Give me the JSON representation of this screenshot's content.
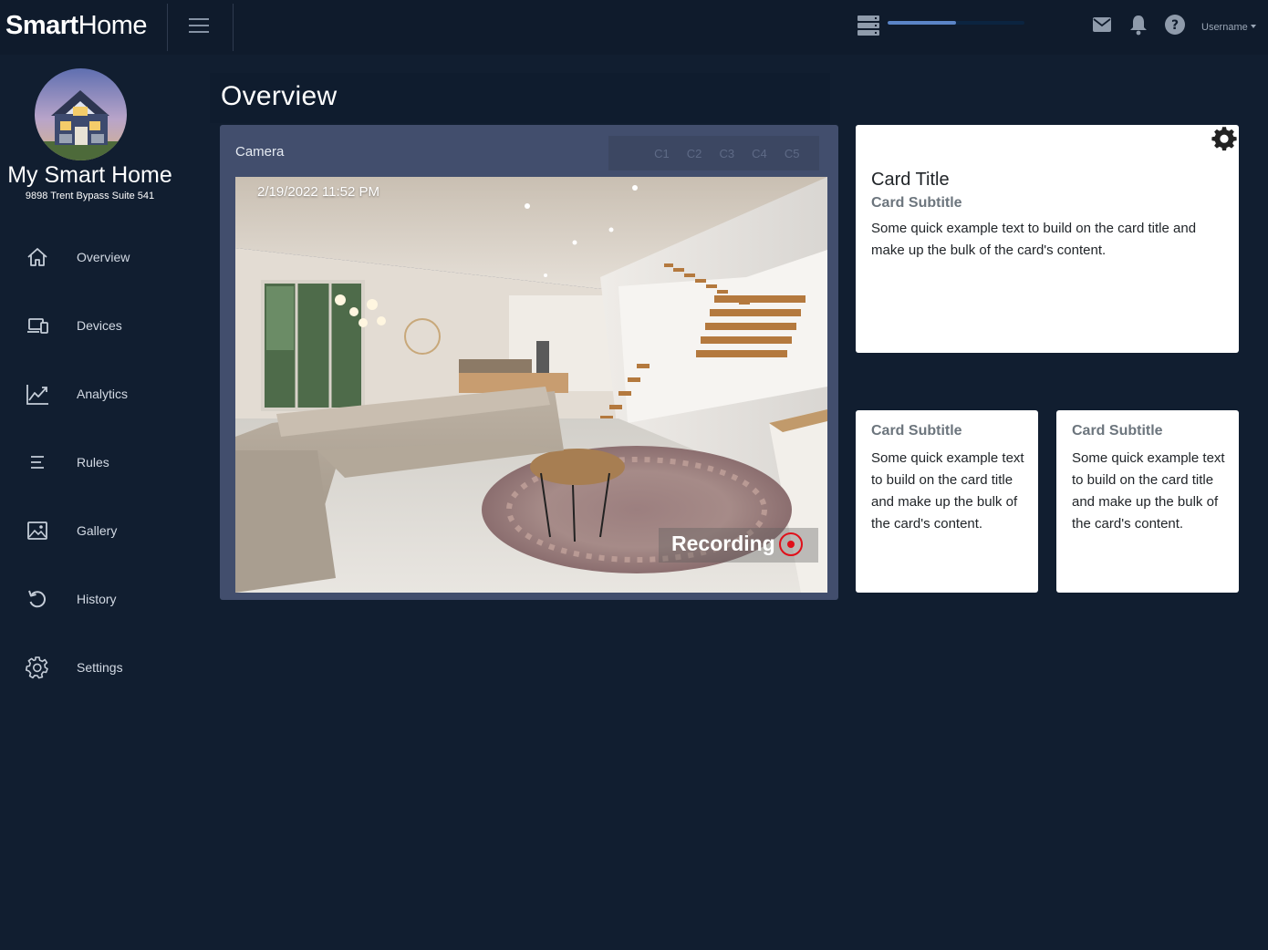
{
  "topbar": {
    "brand_bold": "Smart",
    "brand_light": "Home",
    "progress_fraction": 0.5,
    "username": "Username"
  },
  "sidebar": {
    "home_name": "My Smart Home",
    "home_address": "9898 Trent Bypass Suite 541",
    "items": [
      {
        "label": "Overview",
        "icon": "home-icon"
      },
      {
        "label": "Devices",
        "icon": "devices-icon"
      },
      {
        "label": "Analytics",
        "icon": "analytics-icon"
      },
      {
        "label": "Rules",
        "icon": "rules-icon"
      },
      {
        "label": "Gallery",
        "icon": "gallery-icon"
      },
      {
        "label": "History",
        "icon": "history-icon"
      },
      {
        "label": "Settings",
        "icon": "settings-icon"
      }
    ]
  },
  "main": {
    "title": "Overview",
    "camera": {
      "label": "Camera",
      "tabs": [
        "C1",
        "C2",
        "C3",
        "C4",
        "C5"
      ],
      "timestamp": "2/19/2022 11:52 PM",
      "recording_label": "Recording"
    },
    "card_main": {
      "title": "Card Title",
      "subtitle": "Card Subtitle",
      "text": "Some quick example text to build on the card title and make up the bulk of the card's content."
    },
    "card_small_1": {
      "subtitle": "Card Subtitle",
      "text": "Some quick example text to build on the card title and make up the bulk of the card's content."
    },
    "card_small_2": {
      "subtitle": "Card Subtitle",
      "text": "Some quick example text to build on the card title and make up the bulk of the card's content."
    }
  },
  "colors": {
    "background": "#111e30",
    "camera_panel": "#424e6d",
    "progress": "#5b85c8",
    "record": "#e0101a"
  }
}
